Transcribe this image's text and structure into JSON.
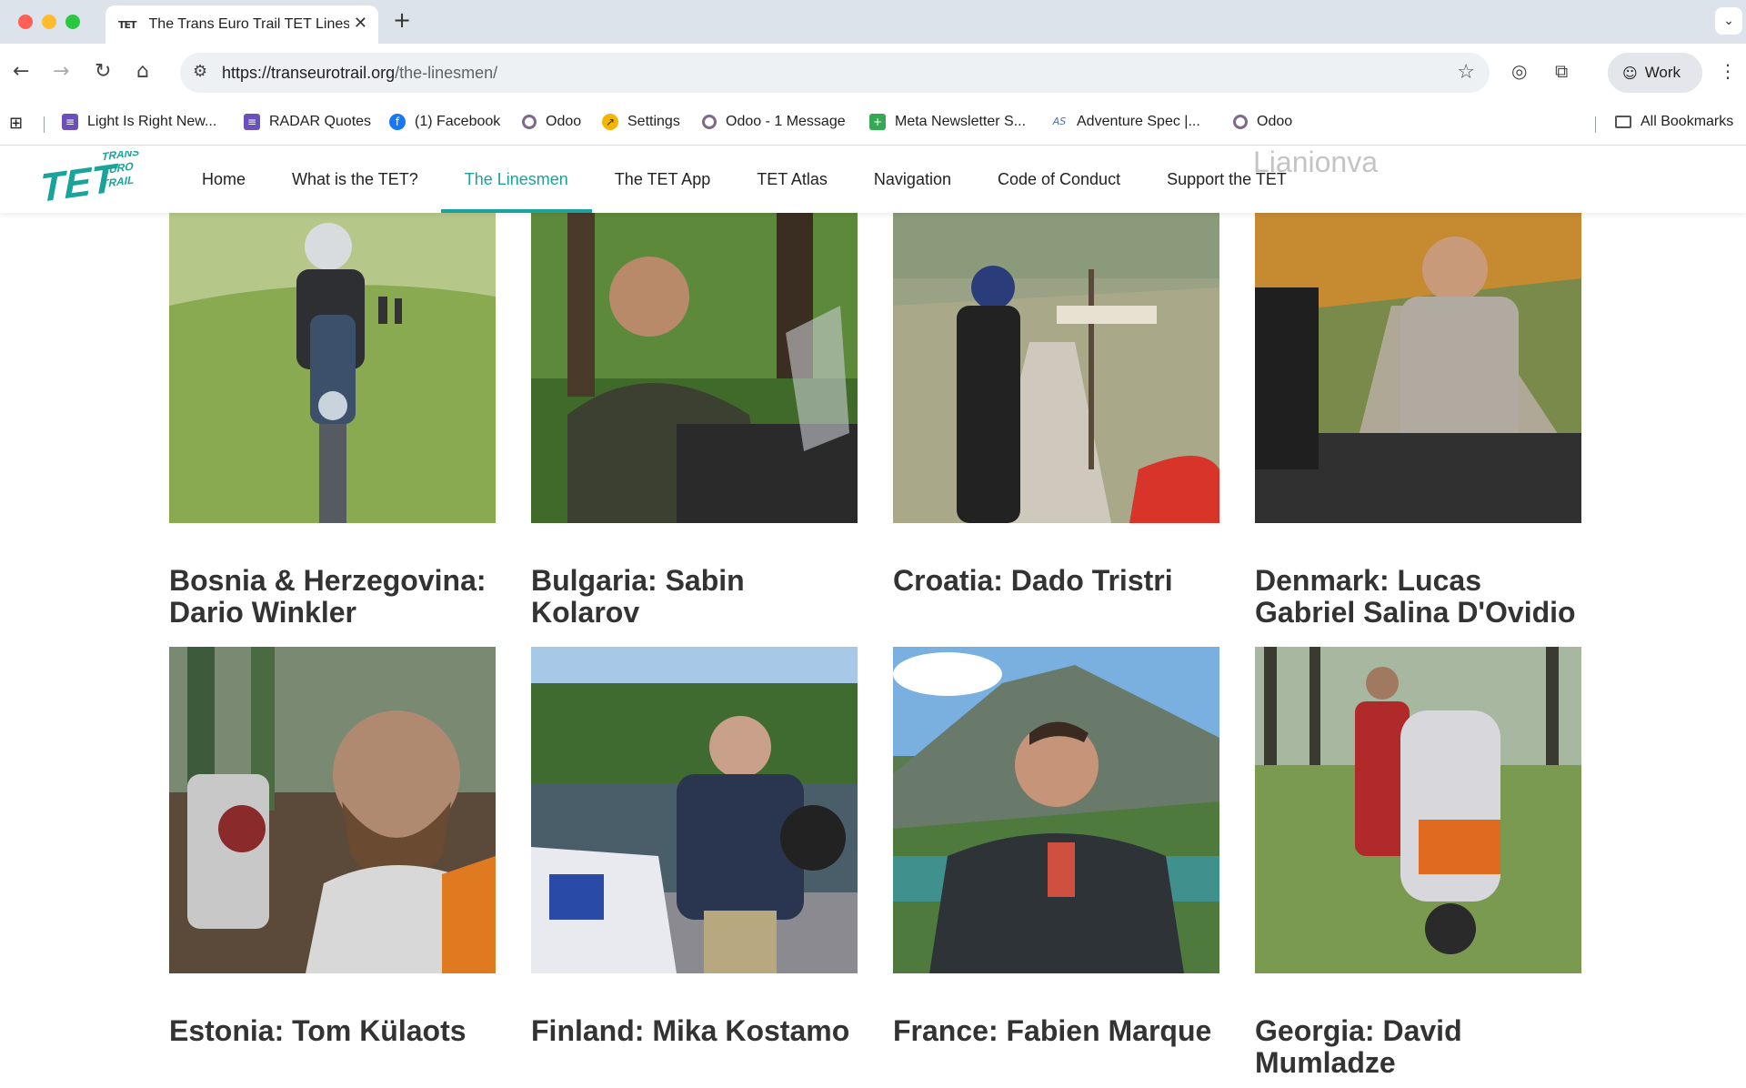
{
  "browser": {
    "tab_title": "The Trans Euro Trail TET Linesmen",
    "tab_favicon": "TET",
    "url_host": "https://transeurotrail.org",
    "url_path": "/the-linesmen/",
    "profile_label": "Work",
    "bookmarks": [
      {
        "label": "Light Is Right New...",
        "icon": "list-icon"
      },
      {
        "label": "RADAR Quotes",
        "icon": "list-icon"
      },
      {
        "label": "(1) Facebook",
        "icon": "facebook-icon"
      },
      {
        "label": "Odoo",
        "icon": "odoo-icon"
      },
      {
        "label": "Settings",
        "icon": "settings-icon"
      },
      {
        "label": "Odoo - 1 Message",
        "icon": "odoo-icon"
      },
      {
        "label": "Meta Newsletter S...",
        "icon": "plus-icon"
      },
      {
        "label": "Adventure Spec |...",
        "icon": "as-icon"
      },
      {
        "label": "Odoo",
        "icon": "odoo-icon"
      }
    ],
    "all_bookmarks": "All Bookmarks"
  },
  "site": {
    "logo": {
      "line1": "TET",
      "line2": "TRANS",
      "line3": "EURO",
      "line4": "TRAIL"
    },
    "nav": [
      "Home",
      "What is the TET?",
      "The Linesmen",
      "The TET App",
      "TET Atlas",
      "Navigation",
      "Code of Conduct",
      "Support the TET"
    ],
    "active_nav": "The Linesmen",
    "ghost_text": "Lianionva"
  },
  "linesmen": [
    {
      "title": "Bosnia & Herzegovina: Dario Winkler",
      "photo": "rider-on-motorcycle-meadow"
    },
    {
      "title": "Bulgaria: Sabin Kolarov",
      "photo": "rider-forest-smiling"
    },
    {
      "title": "Croatia: Dado Tristri",
      "photo": "rider-signpost-mountain"
    },
    {
      "title": "Denmark: Lucas Gabriel Salina D'Ovidio",
      "photo": "rider-autumn-road"
    },
    {
      "title": "Estonia: Tom Külaots",
      "photo": "selfie-muddy-forest"
    },
    {
      "title": "Finland: Mika Kostamo",
      "photo": "rider-lake-helmet"
    },
    {
      "title": "France: Fabien Marque",
      "photo": "portrait-mountain-lake"
    },
    {
      "title": "Georgia: David Mumladze",
      "photo": "rider-tall-grass"
    }
  ]
}
